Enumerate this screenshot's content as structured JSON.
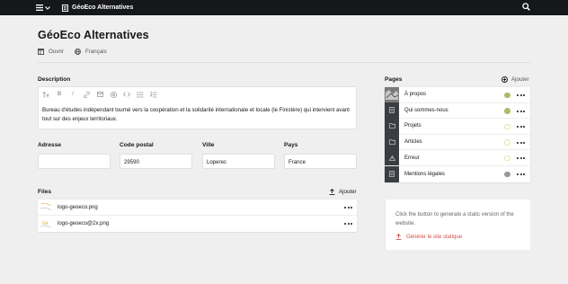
{
  "topbar": {
    "menu_icon": "hamburger-icon",
    "site_title": "GéoEco Alternatives"
  },
  "header": {
    "title": "GéoEco Alternatives",
    "open_label": "Ouvrir",
    "language_label": "Français"
  },
  "description": {
    "label": "Description",
    "text": "Bureau d'études indépendant tourné vers la coopération et la solidarité internationale et locale (le Finistère) qui intervient avant tout sur des enjeux territoriaux."
  },
  "address": {
    "adresse_label": "Adresse",
    "adresse_value": "",
    "code_postal_label": "Code postal",
    "code_postal_value": "29590",
    "ville_label": "Ville",
    "ville_value": "Loperec",
    "pays_label": "Pays",
    "pays_value": "France"
  },
  "files": {
    "label": "Files",
    "upload_label": "Ajouter",
    "items": [
      {
        "name": "logo-geoeco.png"
      },
      {
        "name": "logo-geoeco@2x.png"
      }
    ]
  },
  "pages": {
    "label": "Pages",
    "add_label": "Ajouter",
    "items": [
      {
        "title": "À propos",
        "status": "listed"
      },
      {
        "title": "Qui sommes-nous",
        "status": "listed"
      },
      {
        "title": "Projets",
        "status": "unlisted"
      },
      {
        "title": "Articles",
        "status": "unlisted"
      },
      {
        "title": "Erreur",
        "status": "unlisted"
      },
      {
        "title": "Mentions légales",
        "status": "draft"
      }
    ]
  },
  "static_site": {
    "text": "Click the button to generate a static version of the website.",
    "button_label": "Générer le site statique"
  },
  "colors": {
    "topbar": "#16171a",
    "listed": "#a7bd68",
    "draft": "#999999",
    "accent_red": "#d14e48"
  }
}
